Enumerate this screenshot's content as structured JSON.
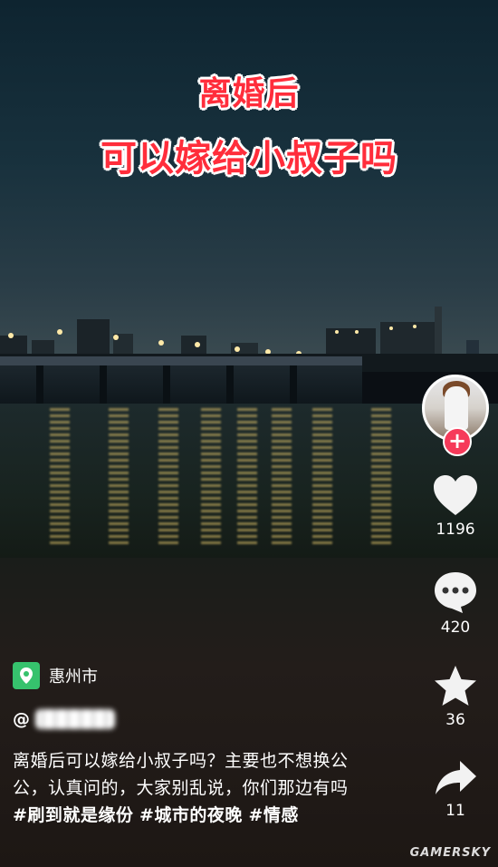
{
  "overlay": {
    "title_line1": "离婚后",
    "title_line2": "可以嫁给小叔子吗"
  },
  "sidebar": {
    "likes": "1196",
    "comments": "420",
    "favorites": "36",
    "shares": "11"
  },
  "post": {
    "location": "惠州市",
    "username_prefix": "@",
    "caption_text": "离婚后可以嫁给小叔子吗？主要也不想换公公，认真问的，大家别乱说，你们那边有吗",
    "hashtags": [
      "#刷到就是缘份",
      "#城市的夜晚",
      "#情感"
    ]
  },
  "watermark": "GAMERSKY",
  "colors": {
    "title_red": "#ff2d3b",
    "follow_pink": "#f63a5a",
    "location_green": "#36c26d"
  }
}
